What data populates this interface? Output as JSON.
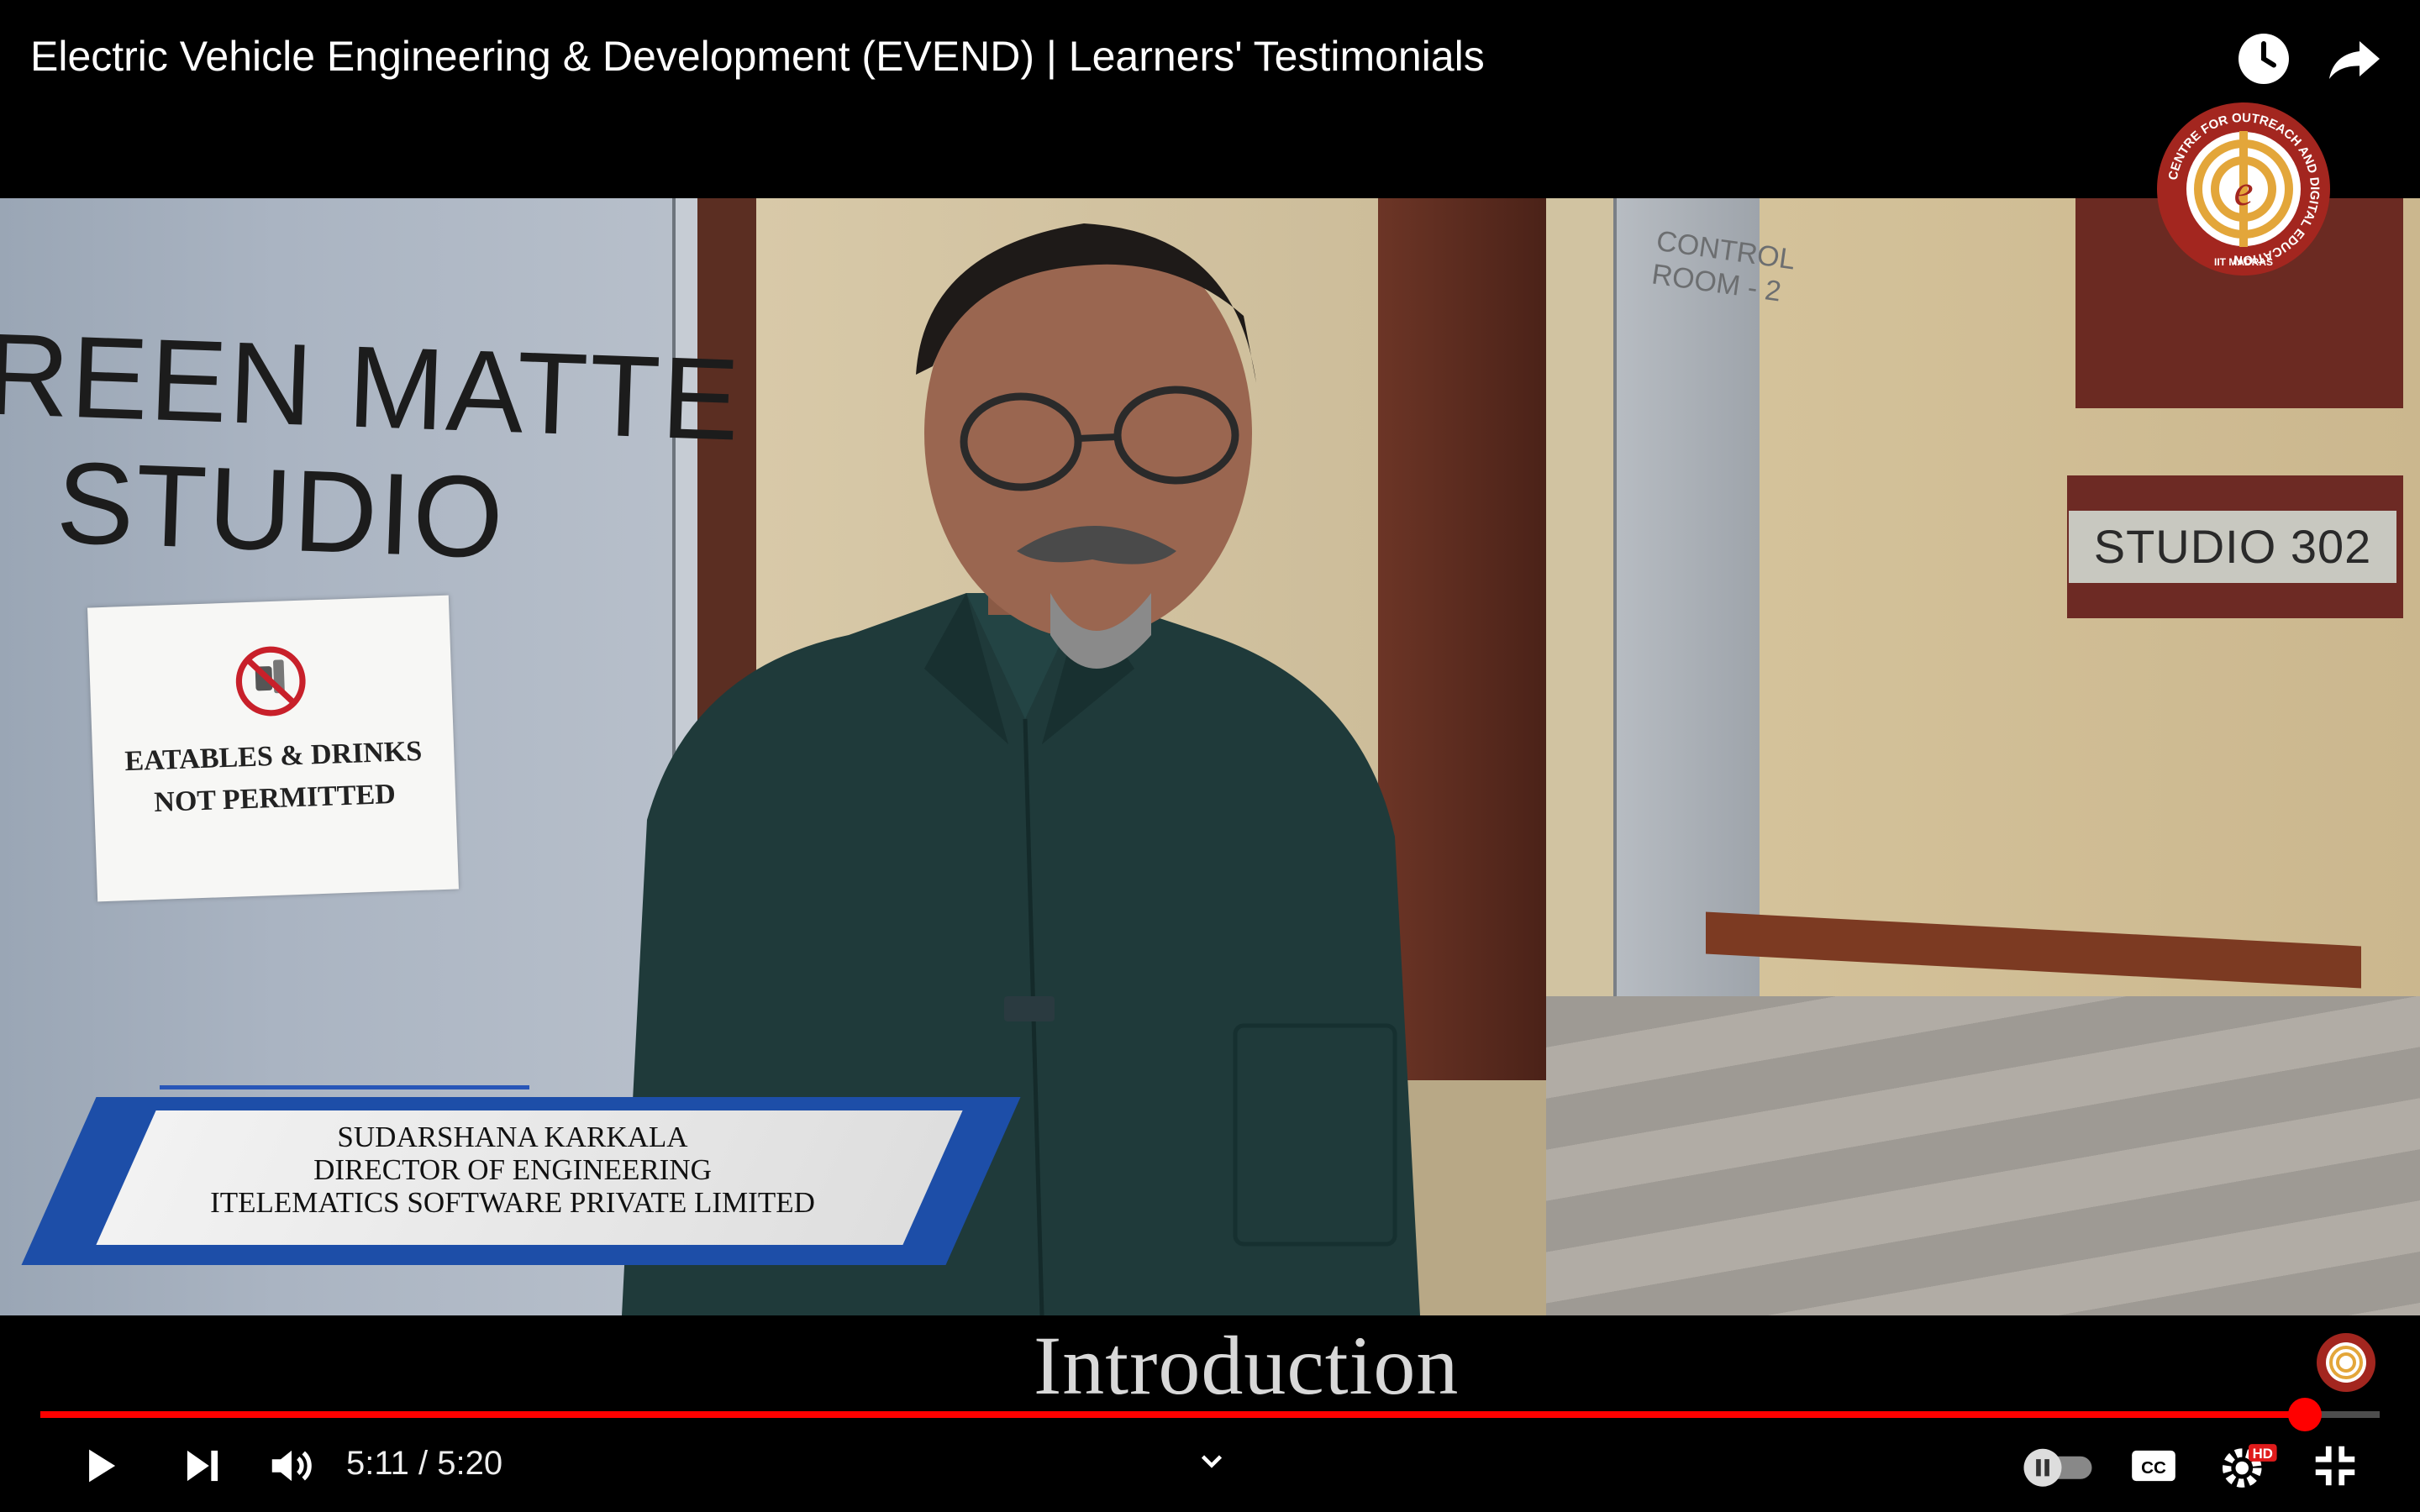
{
  "player": {
    "title": "Electric Vehicle Engineering & Development (EVEND) | Learners' Testimonials",
    "section_caption": "Introduction",
    "current_time": "5:11",
    "separator": " / ",
    "duration": "5:20",
    "progress_fraction": 0.968,
    "accent_color": "#ff0000",
    "quality_badge": "HD"
  },
  "scene": {
    "door_sign_line1": "REEN MATTE",
    "door_sign_line2": "STUDIO",
    "notice_line1": "EATABLES & DRINKS",
    "notice_line2": "NOT PERMITTED",
    "room_sign": "STUDIO 302",
    "control_room_line1": "CONTROL",
    "control_room_line2": "ROOM - 2"
  },
  "lower_third": {
    "name": "SUDARSHANA KARKALA",
    "role": "DIRECTOR OF ENGINEERING",
    "company": "ITELEMATICS SOFTWARE PRIVATE LIMITED"
  },
  "logo": {
    "ring_text": "CENTRE FOR OUTREACH AND DIGITAL EDUCATION",
    "bottom_text": "IIT MADRAS",
    "colors": {
      "ring": "#a3261f",
      "gold": "#e3a63a"
    }
  },
  "icons": {
    "watch_later": "clock-icon",
    "share": "share-icon",
    "play": "play-icon",
    "next": "next-icon",
    "volume": "volume-icon",
    "autoplay": "autoplay-toggle-icon",
    "captions": "captions-icon",
    "settings": "settings-icon",
    "exit_fullscreen": "exit-fullscreen-icon"
  }
}
